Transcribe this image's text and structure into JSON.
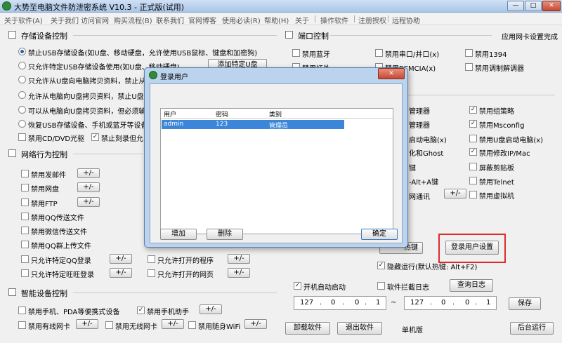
{
  "window": {
    "title": "大势至电脑文件防泄密系统 V10.3 - 正式版(试用)"
  },
  "menu": [
    "关于软件(A)",
    "关于我们",
    "访问官网",
    "购买流程(B)",
    "联系我们",
    "官网博客",
    "使用必读(R)",
    "帮助(H)",
    "关于",
    "操作软件",
    "注册授权",
    "远程协助"
  ],
  "storage": {
    "title": "存储设备控制",
    "options": [
      "禁止USB存储设备(如U盘、移动硬盘，允许使用USB鼠标、键盘和加密狗)",
      "只允许特定USB存储设备使用(如U盘、移动硬盘)",
      "只允许从U盘向电脑拷贝资料，禁止从电脑",
      "允许从电脑向U盘拷贝资料，禁止U盘向电",
      "可以从电脑向U盘拷贝资料，但必须输入管",
      "恢复USB存储设备、手机或蓝牙等设备的使"
    ],
    "add_udisk": "添加特定U盘",
    "cd_disable": "禁用CD/DVD光驱",
    "burn_disable": "禁止刻录但允"
  },
  "network": {
    "title": "网络行为控制",
    "items": [
      "禁用发邮件",
      "禁用网盘",
      "禁用FTP",
      "禁用QQ传送文件",
      "禁用微信传送文件",
      "禁用QQ群上传文件"
    ],
    "qq_only": "只允许特定QQ登录",
    "ww_only": "只允许特定旺旺登录",
    "prog_only": "只允许打开的程序",
    "web_only": "只允许打开的网页",
    "plusminus": "+/-"
  },
  "smart": {
    "title": "智能设备控制",
    "phone_pda": "禁用手机、PDA等便携式设备",
    "phone_helper": "禁用手机助手",
    "wired_nic": "禁用有线网卡",
    "wifi_nic": "禁用无线网卡",
    "portable_wifi": "禁用随身WiFi"
  },
  "port": {
    "title": "端口控制",
    "app_nic": "应用网卡设置完成",
    "bluetooth": "禁用蓝牙",
    "serial": "禁用串口/并口(x)",
    "ieee1394": "禁用1394",
    "infrared": "禁用红外",
    "pcmcia": "禁用PCMCIA(x)",
    "modem": "禁用调制解调器"
  },
  "system": {
    "mgr1": "管理器",
    "group_policy": "禁用组策略",
    "mgr2": "管理器",
    "msconfig": "禁用Msconfig",
    "boot_pc": "启动电脑(x)",
    "usb_boot": "禁用U盘启动电脑(x)",
    "ghost": "化和Ghost",
    "ip_mac": "禁用修改IP/Mac",
    "key1": "键",
    "clipboard": "屏蔽剪贴板",
    "alt_a": "-Alt+A键",
    "telnet": "禁用Telnet",
    "net_comm": "网通讯",
    "vm": "禁用虚拟机"
  },
  "bottom": {
    "hotkey_btn": "热键",
    "login_settings": "登录用户设置",
    "hidden_run": "隐藏运行(默认热键: Alt+F2)",
    "autostart": "开机自动启动",
    "intercept_log": "软件拦截日志",
    "query_log": "查询日志",
    "ip_from": [
      "127",
      "0",
      "0",
      "1"
    ],
    "ip_to": [
      "127",
      "0",
      "0",
      "1"
    ],
    "save": "保存",
    "uninstall": "卸载软件",
    "exit": "退出软件",
    "edition": "单机版",
    "background": "后台运行"
  },
  "dialog": {
    "title": "登录用户",
    "columns": [
      "用户",
      "密码",
      "类别"
    ],
    "rows": [
      {
        "user": "admin",
        "password": "123",
        "role": "管理员"
      }
    ],
    "add": "增加",
    "delete": "删除",
    "ok": "确定"
  },
  "colors": {
    "selection": "#3b86d8",
    "highlight_box": "#e02a2a"
  }
}
